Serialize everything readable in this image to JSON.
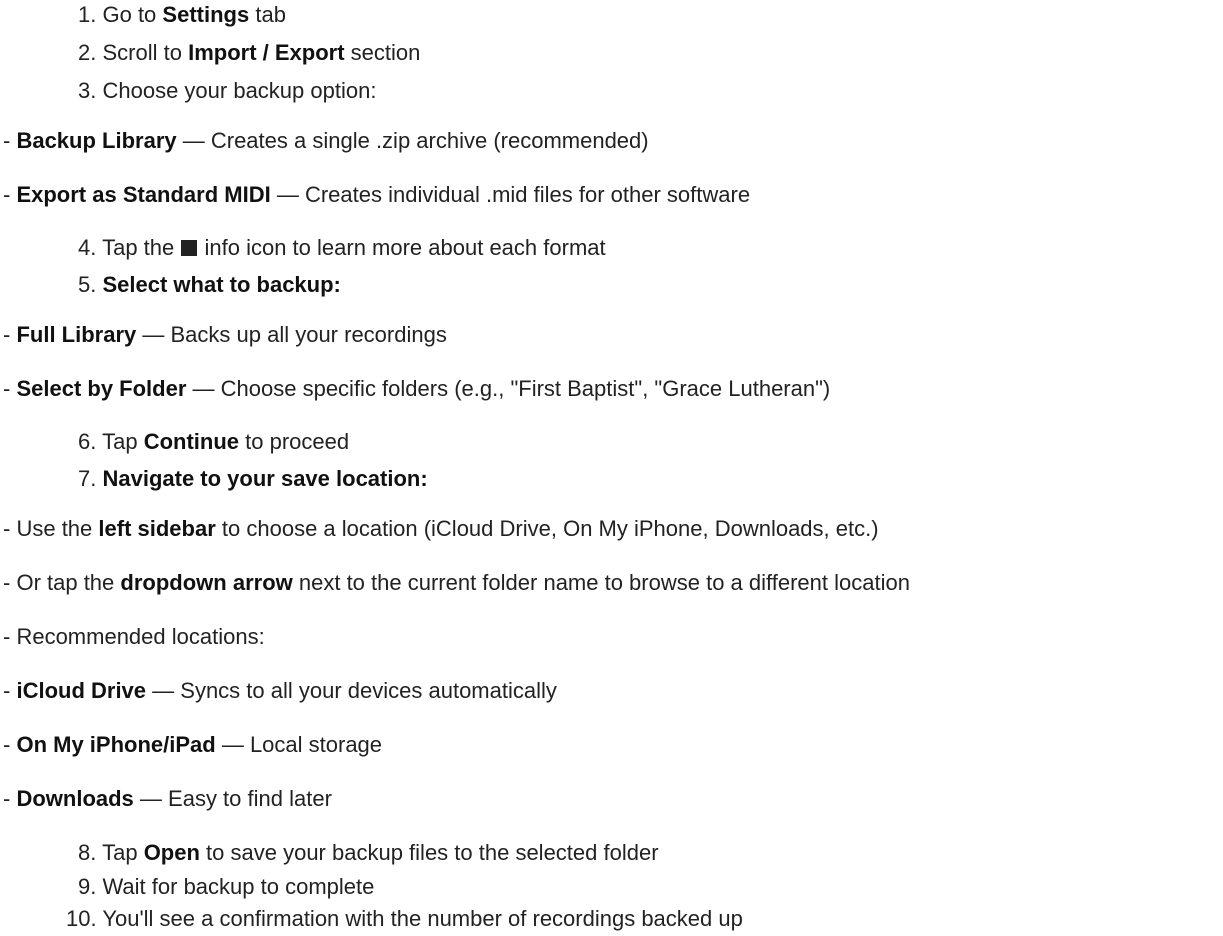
{
  "steps": {
    "s1": {
      "num": "1.",
      "pre": "Go to",
      "bold": "Settings",
      "post": "tab"
    },
    "s2": {
      "num": "2.",
      "pre": "Scroll to",
      "bold": "Import / Export",
      "post": "section"
    },
    "s3": {
      "num": "3.",
      "text": "Choose your backup option:"
    },
    "s4": {
      "num": "4.",
      "pre": "Tap the",
      "post": "info icon to learn more about each format"
    },
    "s5": {
      "num": "5.",
      "bold": "Select what to backup:"
    },
    "s6": {
      "num": "6.",
      "pre": "Tap",
      "bold": "Continue",
      "post": "to proceed"
    },
    "s7": {
      "num": "7.",
      "bold": "Navigate to your save location:"
    },
    "s8": {
      "num": "8.",
      "pre": "Tap",
      "bold": "Open",
      "post": "to save your backup files to the selected folder"
    },
    "s9": {
      "num": "9.",
      "text": "Wait for backup to complete"
    },
    "s10": {
      "num": "10.",
      "text": "You'll see a confirmation with the number of recordings backed up"
    }
  },
  "bullets": {
    "backup_library": {
      "dash": "-",
      "bold": "Backup Library",
      "text": "— Creates a single .zip archive (recommended)"
    },
    "export_midi": {
      "dash": "-",
      "bold": "Export as Standard MIDI",
      "text": "— Creates individual .mid files for other software"
    },
    "full_library": {
      "dash": "-",
      "bold": "Full Library",
      "text": "— Backs up all your recordings"
    },
    "select_folder": {
      "dash": "-",
      "bold": "Select by Folder",
      "text": "— Choose specific folders (e.g., \"First Baptist\", \"Grace Lutheran\")"
    },
    "left_sidebar": {
      "dash": "-",
      "pre": "Use the",
      "bold": "left sidebar",
      "post": "to choose a location (iCloud Drive, On My iPhone, Downloads, etc.)"
    },
    "dropdown_arrow": {
      "dash": "-",
      "pre": "Or tap the",
      "bold": "dropdown arrow",
      "post": "next to the current folder name to browse to a different location"
    },
    "recommended": {
      "dash": "-",
      "text": "Recommended locations:"
    },
    "icloud": {
      "dash": "-",
      "bold": "iCloud Drive",
      "text": "— Syncs to all your devices automatically"
    },
    "on_my_iphone": {
      "dash": "-",
      "bold": "On My iPhone/iPad",
      "text": "— Local storage"
    },
    "downloads": {
      "dash": "-",
      "bold": "Downloads",
      "text": "— Easy to find later"
    }
  },
  "icons": {
    "info": "info-square-icon"
  }
}
